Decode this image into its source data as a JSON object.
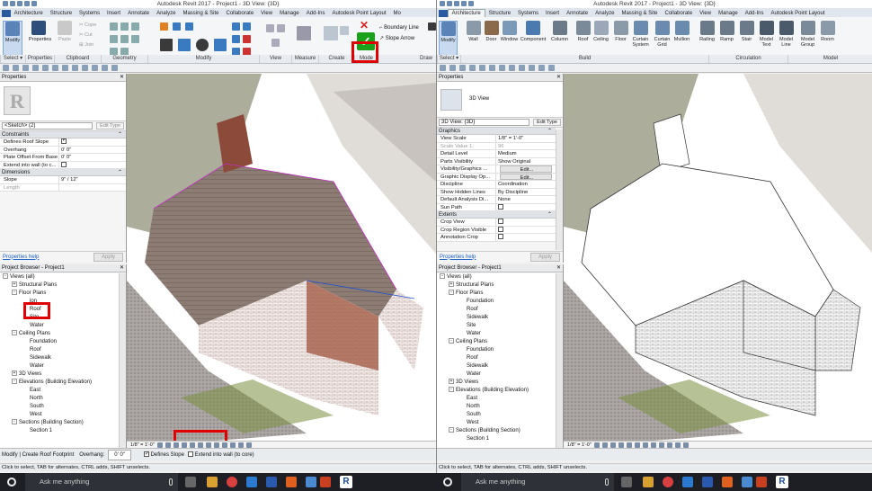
{
  "title_left": "Autodesk Revit 2017 -   Project1 - 3D View: {3D}",
  "title_right": "Autodesk Revit 2017 -   Project1 - 3D View: {3D}",
  "left": {
    "tabs": [
      "Architecture",
      "Structure",
      "Systems",
      "Insert",
      "Annotate",
      "Analyze",
      "Massing & Site",
      "Collaborate",
      "View",
      "Manage",
      "Add-Ins",
      "Autodesk Point Layout",
      "Mo"
    ],
    "modify_label": "Modify",
    "properties_label": "Properties",
    "clipboard": [
      "Paste",
      "Cope",
      "Cut",
      "Join"
    ],
    "ribbon_small": [
      "Boundary Line",
      "Slope Arrow"
    ],
    "groups": [
      "Select ▾",
      "Properties",
      "Clipboard",
      "Geometry",
      "Modify",
      "View",
      "Measure",
      "Create",
      "Mode",
      "Draw"
    ],
    "properties": {
      "title": "Properties",
      "type_label": "",
      "selector": "<Sketch> (2)",
      "edit_type": "Edit Type",
      "categories": [
        {
          "name": "Constraints",
          "rows": [
            {
              "k": "Defines Roof Slope",
              "v": "",
              "check": true,
              "checked": true
            },
            {
              "k": "Overhang",
              "v": "0'  0\""
            },
            {
              "k": "Plate Offset From Base",
              "v": "0'  0\""
            },
            {
              "k": "Extend into wall (to c...",
              "v": "",
              "check": true,
              "checked": false
            }
          ]
        },
        {
          "name": "Dimensions",
          "rows": [
            {
              "k": "Slope",
              "v": "9\" / 12\""
            },
            {
              "k": "Length",
              "v": "",
              "grey": true
            }
          ]
        }
      ],
      "help": "Properties help",
      "apply": "Apply"
    },
    "browser": {
      "title": "Project Browser - Project1",
      "nodes": [
        {
          "t": "Views (all)",
          "lvl": 0,
          "tog": "-"
        },
        {
          "t": "Structural Plans",
          "lvl": 1,
          "tog": "+"
        },
        {
          "t": "Floor Plans",
          "lvl": 1,
          "tog": "-"
        },
        {
          "t": "ion",
          "lvl": 2,
          "tog": ""
        },
        {
          "t": "Roof",
          "lvl": 2,
          "tog": ""
        },
        {
          "t": "Site",
          "lvl": 2,
          "tog": ""
        },
        {
          "t": "Water",
          "lvl": 2,
          "tog": ""
        },
        {
          "t": "Ceiling Plans",
          "lvl": 1,
          "tog": "-"
        },
        {
          "t": "Foundation",
          "lvl": 2,
          "tog": ""
        },
        {
          "t": "Roof",
          "lvl": 2,
          "tog": ""
        },
        {
          "t": "Sidewalk",
          "lvl": 2,
          "tog": ""
        },
        {
          "t": "Water",
          "lvl": 2,
          "tog": ""
        },
        {
          "t": "3D Views",
          "lvl": 1,
          "tog": "+"
        },
        {
          "t": "Elevations (Building Elevation)",
          "lvl": 1,
          "tog": "-"
        },
        {
          "t": "East",
          "lvl": 2,
          "tog": ""
        },
        {
          "t": "North",
          "lvl": 2,
          "tog": ""
        },
        {
          "t": "South",
          "lvl": 2,
          "tog": ""
        },
        {
          "t": "West",
          "lvl": 2,
          "tog": ""
        },
        {
          "t": "Sections (Building Section)",
          "lvl": 1,
          "tog": "-"
        },
        {
          "t": "Section 1",
          "lvl": 2,
          "tog": ""
        }
      ]
    },
    "view_scale": "1/8\" = 1'-0\"",
    "status": "Modify | Create Roof Footprint",
    "overhang_label": "Overhang:",
    "overhang_value": "0'  0\"",
    "defines_slope": "Defines Slope",
    "extend_label": "Extend into wall (to core)",
    "hint": "Click to select, TAB for alternates, CTRL adds, SHIFT unselects."
  },
  "right": {
    "tabs": [
      "Architecture",
      "Structure",
      "Systems",
      "Insert",
      "Annotate",
      "Analyze",
      "Massing & Site",
      "Collaborate",
      "View",
      "Manage",
      "Add-Ins",
      "Autodesk Point Layout"
    ],
    "tools": [
      "Modify",
      "Wall",
      "Door",
      "Window",
      "Component",
      "Column",
      "Roof",
      "Ceiling",
      "Floor",
      "Curtain System",
      "Curtain Grid",
      "Mullion",
      "Railing",
      "Ramp",
      "Stair",
      "Model Text",
      "Model Line",
      "Model Group",
      "Room"
    ],
    "groups": [
      "Select ▾",
      "Build",
      "Circulation",
      "Model"
    ],
    "properties": {
      "title": "Properties",
      "type_label": "3D View",
      "selector": "3D View: {3D}",
      "edit_type": "Edit Type",
      "categories": [
        {
          "name": "Graphics",
          "rows": [
            {
              "k": "View Scale",
              "v": "1/8\" = 1'-0\""
            },
            {
              "k": "Scale Value    1:",
              "v": "96",
              "grey": true
            },
            {
              "k": "Detail Level",
              "v": "Medium"
            },
            {
              "k": "Parts Visibility",
              "v": "Show Original"
            },
            {
              "k": "Visibility/Graphics ...",
              "v": "Edit...",
              "btn": true
            },
            {
              "k": "Graphic Display Op...",
              "v": "Edit...",
              "btn": true
            },
            {
              "k": "Discipline",
              "v": "Coordination"
            },
            {
              "k": "Show Hidden Lines",
              "v": "By Discipline"
            },
            {
              "k": "Default Analysis Di...",
              "v": "None"
            },
            {
              "k": "Sun Path",
              "v": "",
              "check": true,
              "checked": false
            }
          ]
        },
        {
          "name": "Extents",
          "rows": [
            {
              "k": "Crop View",
              "v": "",
              "check": true,
              "checked": false
            },
            {
              "k": "Crop Region Visible",
              "v": "",
              "check": true,
              "checked": false
            },
            {
              "k": "Annotation Crop",
              "v": "",
              "check": true,
              "checked": false
            }
          ]
        }
      ],
      "help": "Properties help",
      "apply": "Apply"
    },
    "browser": {
      "title": "Project Browser - Project1",
      "nodes": [
        {
          "t": "Views (all)",
          "lvl": 0,
          "tog": "-"
        },
        {
          "t": "Structural Plans",
          "lvl": 1,
          "tog": "+"
        },
        {
          "t": "Floor Plans",
          "lvl": 1,
          "tog": "-"
        },
        {
          "t": "Foundation",
          "lvl": 2,
          "tog": ""
        },
        {
          "t": "Roof",
          "lvl": 2,
          "tog": ""
        },
        {
          "t": "Sidewalk",
          "lvl": 2,
          "tog": ""
        },
        {
          "t": "Site",
          "lvl": 2,
          "tog": ""
        },
        {
          "t": "Water",
          "lvl": 2,
          "tog": ""
        },
        {
          "t": "Ceiling Plans",
          "lvl": 1,
          "tog": "-"
        },
        {
          "t": "Foundation",
          "lvl": 2,
          "tog": ""
        },
        {
          "t": "Roof",
          "lvl": 2,
          "tog": ""
        },
        {
          "t": "Sidewalk",
          "lvl": 2,
          "tog": ""
        },
        {
          "t": "Water",
          "lvl": 2,
          "tog": ""
        },
        {
          "t": "3D Views",
          "lvl": 1,
          "tog": "+"
        },
        {
          "t": "Elevations (Building Elevation)",
          "lvl": 1,
          "tog": "-"
        },
        {
          "t": "East",
          "lvl": 2,
          "tog": ""
        },
        {
          "t": "North",
          "lvl": 2,
          "tog": ""
        },
        {
          "t": "South",
          "lvl": 2,
          "tog": ""
        },
        {
          "t": "West",
          "lvl": 2,
          "tog": ""
        },
        {
          "t": "Sections (Building Section)",
          "lvl": 1,
          "tog": "-"
        },
        {
          "t": "Section 1",
          "lvl": 2,
          "tog": ""
        }
      ]
    },
    "view_scale": "1/8\" = 1'-0\"",
    "hint": "Click to select, TAB for alternates, CTRL adds, SHIFT unselects."
  },
  "taskbar": {
    "search": "Ask me anything"
  },
  "colors": {
    "highlight": "#e00000",
    "accent": "#2a5aa0",
    "finish": "#1aa21a"
  }
}
